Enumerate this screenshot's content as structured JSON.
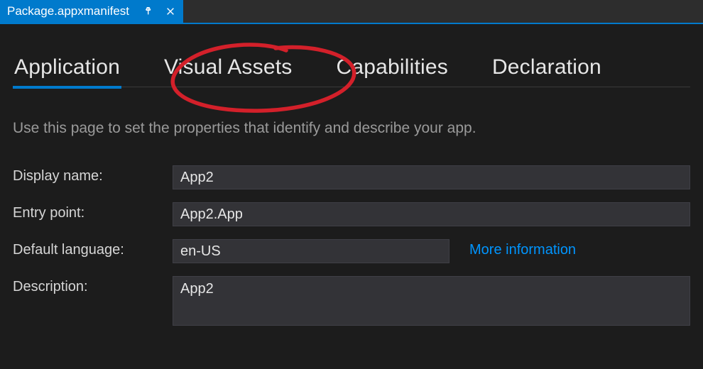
{
  "tab": {
    "file_name": "Package.appxmanifest"
  },
  "sections": {
    "application": "Application",
    "visual_assets": "Visual Assets",
    "capabilities": "Capabilities",
    "declarations": "Declaration"
  },
  "page_description": "Use this page to set the properties that identify and describe your app.",
  "form": {
    "display_name": {
      "label": "Display name:",
      "value": "App2"
    },
    "entry_point": {
      "label": "Entry point:",
      "value": "App2.App"
    },
    "default_language": {
      "label": "Default language:",
      "value": "en-US",
      "more_info": "More information"
    },
    "description": {
      "label": "Description:",
      "value": "App2"
    }
  }
}
